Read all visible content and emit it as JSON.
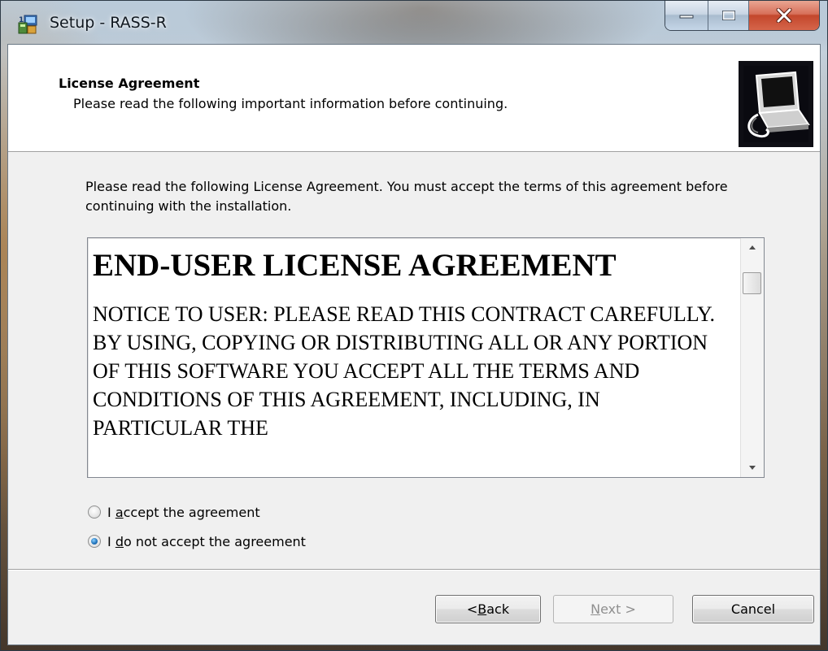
{
  "window": {
    "title": "Setup - RASS-R",
    "caption_buttons": [
      "minimize",
      "maximize",
      "close"
    ]
  },
  "header": {
    "title": "License Agreement",
    "subtitle": "Please read the following important information before continuing."
  },
  "intro_text": "Please read the following License Agreement. You must accept the terms of this agreement before continuing with the installation.",
  "license": {
    "heading": "END-USER LICENSE AGREEMENT",
    "body": "NOTICE TO USER: PLEASE READ THIS CONTRACT CAREFULLY. BY USING, COPYING OR DISTRIBUTING ALL OR ANY PORTION OF THIS SOFTWARE YOU ACCEPT ALL THE TERMS AND CONDITIONS OF THIS AGREEMENT, INCLUDING, IN PARTICULAR THE"
  },
  "options": {
    "accept": {
      "pre": "I ",
      "accel": "a",
      "post": "ccept the agreement",
      "checked": false
    },
    "decline": {
      "pre": "I ",
      "accel": "d",
      "post": "o not accept the agreement",
      "checked": true
    }
  },
  "buttons": {
    "back": {
      "pre": "< ",
      "accel": "B",
      "post": "ack"
    },
    "next": {
      "pre": "",
      "accel": "N",
      "post": "ext >",
      "enabled": false
    },
    "cancel": "Cancel"
  },
  "colors": {
    "close_button": "#c3472c",
    "radio_selected": "#1d6fb8",
    "dialog_bg": "#f0f0f0"
  }
}
